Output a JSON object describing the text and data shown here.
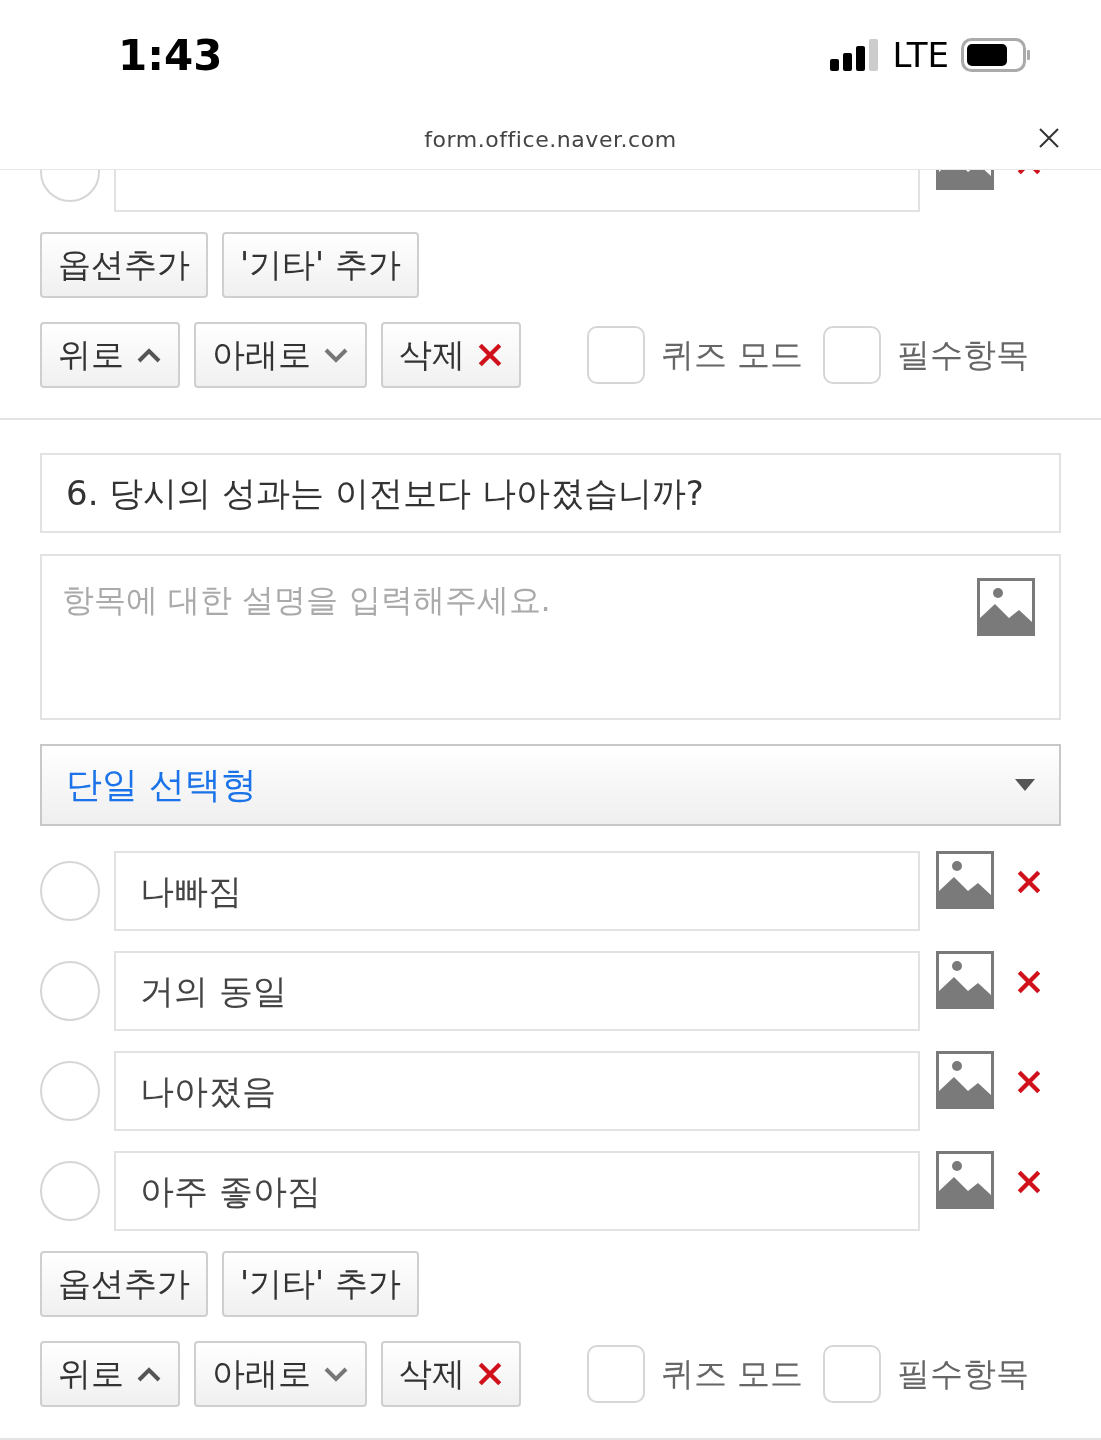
{
  "status_bar": {
    "time": "1:43",
    "network": "LTE"
  },
  "url_bar": {
    "url": "form.office.naver.com"
  },
  "previous_question": {
    "options": [
      {
        "selected": false
      }
    ],
    "add_buttons": [
      "옵션추가",
      "'기타' 추가"
    ],
    "actions": [
      {
        "label": "위로",
        "kind": "up"
      },
      {
        "label": "아래로",
        "kind": "down"
      },
      {
        "label": "삭제",
        "kind": "delete"
      }
    ],
    "toggles": [
      {
        "label": "퀴즈 모드",
        "checked": false
      },
      {
        "label": "필수항목",
        "checked": false
      }
    ]
  },
  "question": {
    "title": "6. 당시의 성과는 이전보다 나아졌습니까?",
    "description_placeholder": "항목에 대한 설명을 입력해주세요.",
    "type": "단일 선택형",
    "options": [
      {
        "value": "나빠짐",
        "selected": false
      },
      {
        "value": "거의 동일",
        "selected": false
      },
      {
        "value": "나아졌음",
        "selected": false
      },
      {
        "value": "아주 좋아짐",
        "selected": false
      }
    ],
    "add_buttons": [
      "옵션추가",
      "'기타' 추가"
    ],
    "actions": [
      {
        "label": "위로",
        "kind": "up"
      },
      {
        "label": "아래로",
        "kind": "down"
      },
      {
        "label": "삭제",
        "kind": "delete"
      }
    ],
    "toggles": [
      {
        "label": "퀴즈 모드",
        "checked": false
      },
      {
        "label": "필수항목",
        "checked": false
      }
    ]
  }
}
